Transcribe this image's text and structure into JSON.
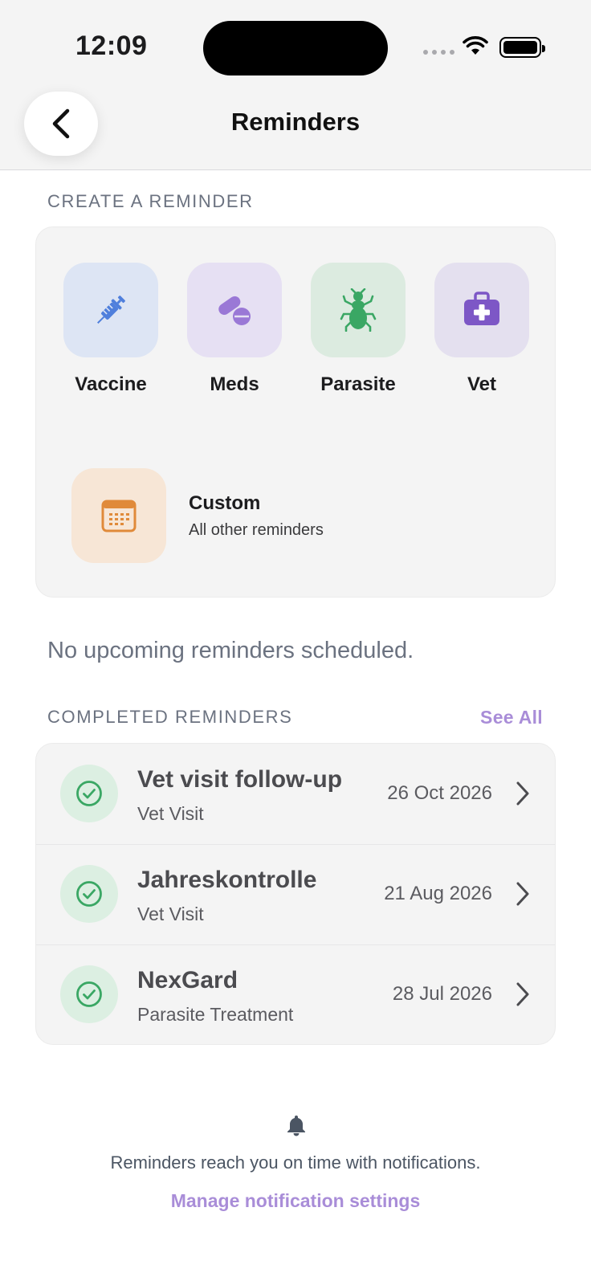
{
  "status_bar": {
    "time": "12:09"
  },
  "header": {
    "title": "Reminders"
  },
  "create": {
    "section_label": "CREATE A REMINDER",
    "categories": [
      {
        "label": "Vaccine",
        "icon": "syringe-icon",
        "tile_color": "#dde5f4",
        "icon_color": "#4f7fdc"
      },
      {
        "label": "Meds",
        "icon": "pill-icon",
        "tile_color": "#e6e0f3",
        "icon_color": "#9a78d6"
      },
      {
        "label": "Parasite",
        "icon": "bug-icon",
        "tile_color": "#dcebe0",
        "icon_color": "#3aa764"
      },
      {
        "label": "Vet",
        "icon": "medkit-icon",
        "tile_color": "#e4e0ef",
        "icon_color": "#7d57c6"
      }
    ],
    "custom": {
      "title": "Custom",
      "subtitle": "All other reminders",
      "icon": "calendar-icon",
      "icon_color": "#e08a3a"
    }
  },
  "upcoming": {
    "empty_text": "No upcoming reminders scheduled."
  },
  "completed": {
    "section_label": "COMPLETED REMINDERS",
    "see_all_label": "See All",
    "items": [
      {
        "title": "Vet visit follow-up",
        "type": "Vet Visit",
        "date": "26 Oct 2026"
      },
      {
        "title": "Jahreskontrolle",
        "type": "Vet Visit",
        "date": "21 Aug 2026"
      },
      {
        "title": "NexGard",
        "type": "Parasite Treatment",
        "date": "28 Jul 2026"
      }
    ]
  },
  "footer": {
    "note": "Reminders reach you on time with notifications.",
    "link_label": "Manage notification settings"
  },
  "colors": {
    "accent": "#a98dd8",
    "success": "#3aa764"
  }
}
